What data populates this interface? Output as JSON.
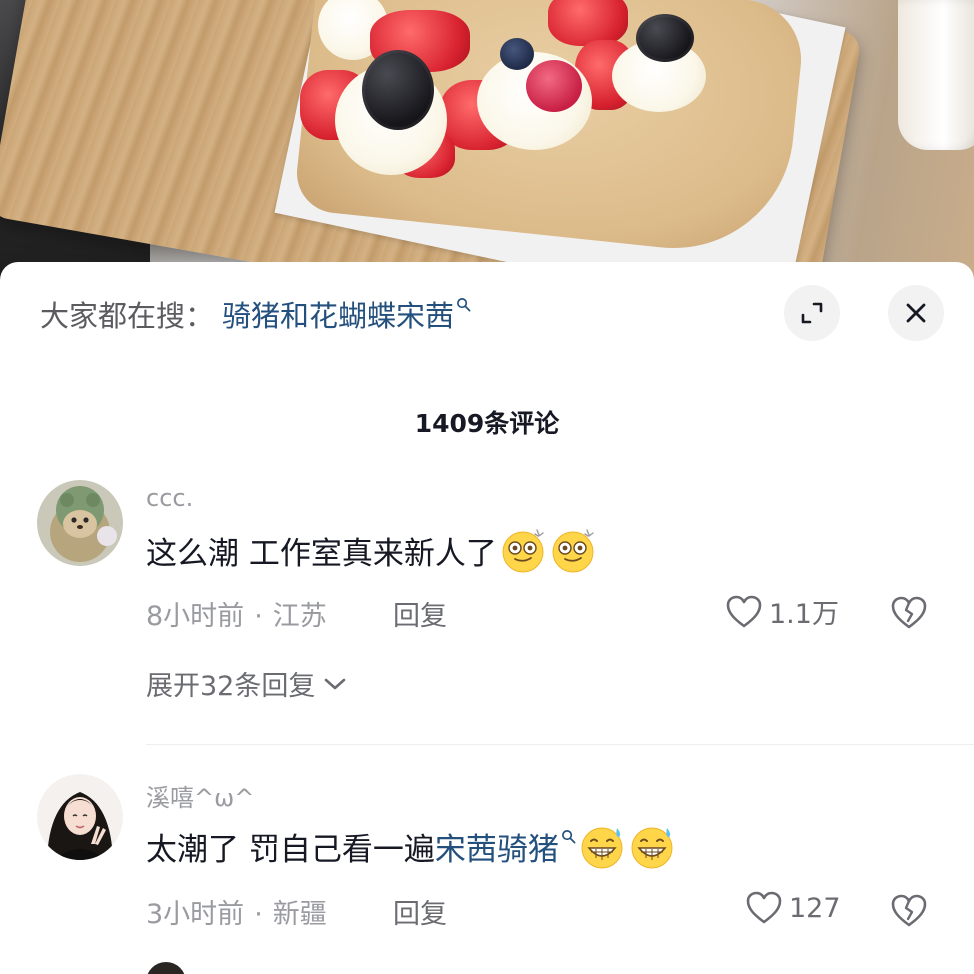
{
  "search_bar": {
    "prefix": "大家都在搜：",
    "term": "骑猪和花蝴蝶宋茜"
  },
  "comments_header": {
    "count_label": "1409条评论"
  },
  "comments": [
    {
      "username": "ccc.",
      "text": "这么潮 工作室真来新人了",
      "emojis": [
        "dizzy-face-emoji",
        "dizzy-face-emoji"
      ],
      "time": "8小时前",
      "location": "江苏",
      "reply_label": "回复",
      "likes": "1.1万",
      "expand_replies_label": "展开32条回复"
    },
    {
      "username": "溪嘻^ω^",
      "text_before": "太潮了 罚自己看一遍",
      "text_link": "宋茜骑猪",
      "emojis": [
        "grin-sweat-emoji",
        "grin-sweat-emoji"
      ],
      "time": "3小时前",
      "location": "新疆",
      "reply_label": "回复",
      "likes": "127"
    }
  ],
  "icons": {
    "expand": "expand-icon",
    "close": "close-icon",
    "like": "heart-outline-icon",
    "dislike": "broken-heart-icon",
    "search_hint": "search-icon",
    "chevron": "chevron-down-icon"
  },
  "colors": {
    "link_blue": "#24507e",
    "secondary_text": "#9a9ba0",
    "primary_text": "#161823"
  }
}
